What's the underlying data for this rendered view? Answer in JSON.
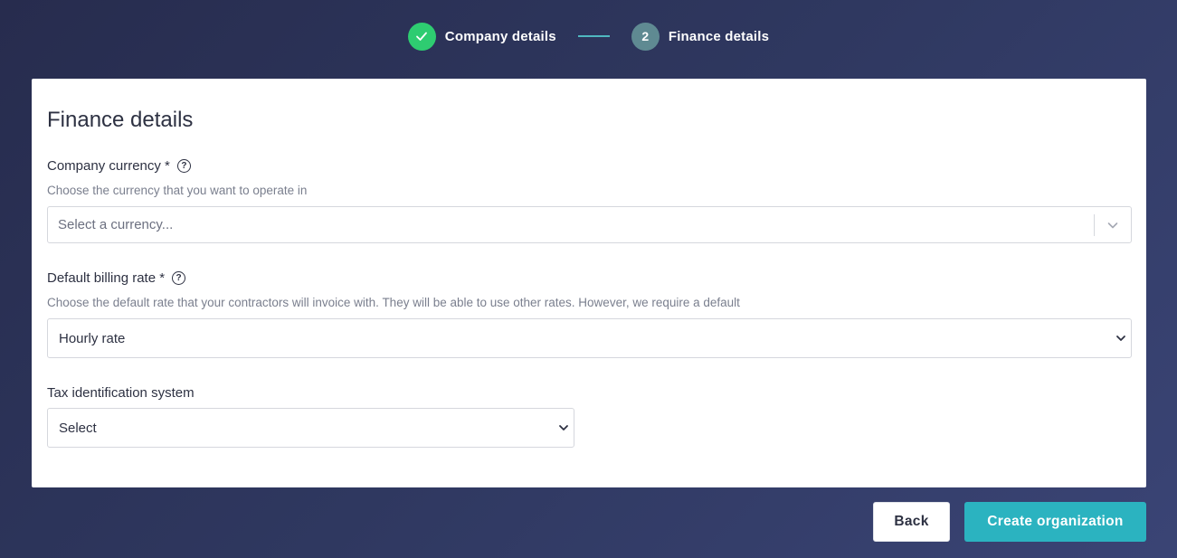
{
  "stepper": {
    "steps": [
      {
        "label": "Company details",
        "state": "completed",
        "marker": "check-icon"
      },
      {
        "label": "Finance details",
        "state": "current",
        "marker": "2"
      }
    ]
  },
  "form": {
    "title": "Finance details",
    "currency": {
      "label": "Company currency *",
      "hint": "Choose the currency that you want to operate in",
      "placeholder": "Select a currency..."
    },
    "billing_rate": {
      "label": "Default billing rate *",
      "hint": "Choose the default rate that your contractors will invoice with. They will be able to use other rates. However, we require a default",
      "value": "Hourly rate"
    },
    "tax_system": {
      "label": "Tax identification system",
      "value": "Select"
    }
  },
  "actions": {
    "back_label": "Back",
    "create_label": "Create organization"
  },
  "colors": {
    "background": "#2f3860",
    "step_done": "#2ecc71",
    "step_current": "#5f8a92",
    "primary_button": "#2bb3c0"
  }
}
